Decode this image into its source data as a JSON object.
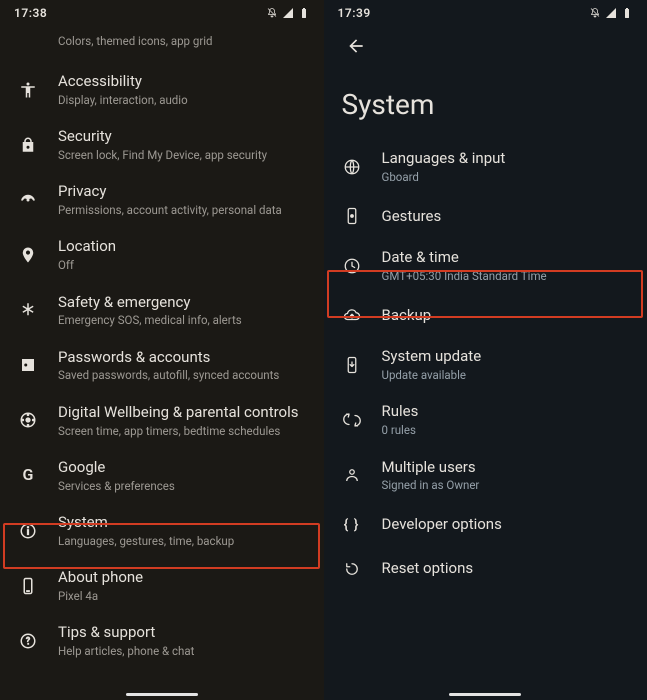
{
  "left": {
    "status_time": "17:38",
    "items": [
      {
        "icon": "palette",
        "t": "",
        "s": "Colors, themed icons, app grid"
      },
      {
        "icon": "accessibility",
        "t": "Accessibility",
        "s": "Display, interaction, audio"
      },
      {
        "icon": "lock",
        "t": "Security",
        "s": "Screen lock, Find My Device, app security"
      },
      {
        "icon": "privacy",
        "t": "Privacy",
        "s": "Permissions, account activity, personal data"
      },
      {
        "icon": "location",
        "t": "Location",
        "s": "Off"
      },
      {
        "icon": "asterisk",
        "t": "Safety & emergency",
        "s": "Emergency SOS, medical info, alerts"
      },
      {
        "icon": "key",
        "t": "Passwords & accounts",
        "s": "Saved passwords, autofill, synced accounts"
      },
      {
        "icon": "wellbeing",
        "t": "Digital Wellbeing & parental controls",
        "s": "Screen time, app timers, bedtime schedules"
      },
      {
        "icon": "google",
        "t": "Google",
        "s": "Services & preferences"
      },
      {
        "icon": "info",
        "t": "System",
        "s": "Languages, gestures, time, backup"
      },
      {
        "icon": "phone",
        "t": "About phone",
        "s": "Pixel 4a"
      },
      {
        "icon": "help",
        "t": "Tips & support",
        "s": "Help articles, phone & chat"
      }
    ]
  },
  "right": {
    "status_time": "17:39",
    "page_title": "System",
    "items": [
      {
        "icon": "globe",
        "t": "Languages & input",
        "s": "Gboard"
      },
      {
        "icon": "gesture",
        "t": "Gestures",
        "s": ""
      },
      {
        "icon": "clock",
        "t": "Date & time",
        "s": "GMT+05:30 India Standard Time"
      },
      {
        "icon": "cloud",
        "t": "Backup",
        "s": ""
      },
      {
        "icon": "sysupdate",
        "t": "System update",
        "s": "Update available"
      },
      {
        "icon": "rules",
        "t": "Rules",
        "s": "0 rules"
      },
      {
        "icon": "users",
        "t": "Multiple users",
        "s": "Signed in as Owner"
      },
      {
        "icon": "dev",
        "t": "Developer options",
        "s": ""
      },
      {
        "icon": "reset",
        "t": "Reset options",
        "s": ""
      }
    ]
  }
}
